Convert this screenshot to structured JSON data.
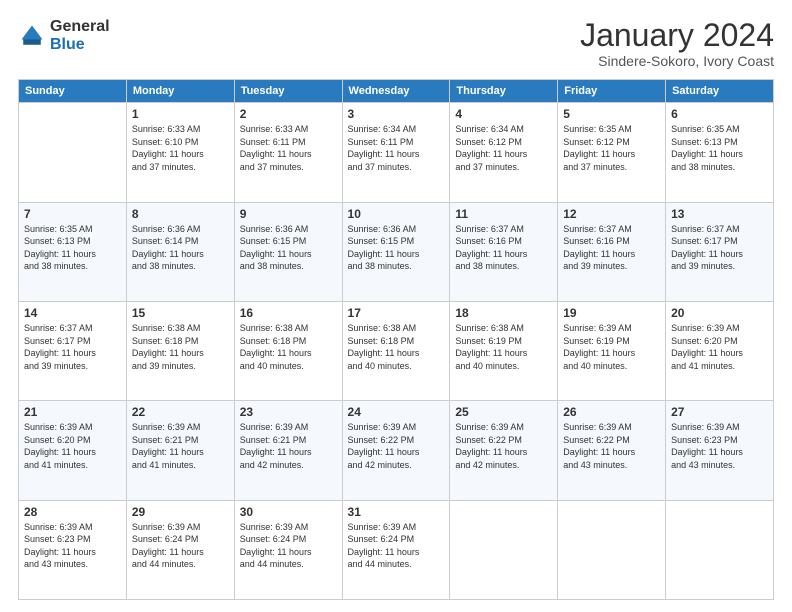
{
  "logo": {
    "general": "General",
    "blue": "Blue"
  },
  "title": "January 2024",
  "subtitle": "Sindere-Sokoro, Ivory Coast",
  "days_of_week": [
    "Sunday",
    "Monday",
    "Tuesday",
    "Wednesday",
    "Thursday",
    "Friday",
    "Saturday"
  ],
  "weeks": [
    [
      {
        "day": "",
        "info": ""
      },
      {
        "day": "1",
        "info": "Sunrise: 6:33 AM\nSunset: 6:10 PM\nDaylight: 11 hours\nand 37 minutes."
      },
      {
        "day": "2",
        "info": "Sunrise: 6:33 AM\nSunset: 6:11 PM\nDaylight: 11 hours\nand 37 minutes."
      },
      {
        "day": "3",
        "info": "Sunrise: 6:34 AM\nSunset: 6:11 PM\nDaylight: 11 hours\nand 37 minutes."
      },
      {
        "day": "4",
        "info": "Sunrise: 6:34 AM\nSunset: 6:12 PM\nDaylight: 11 hours\nand 37 minutes."
      },
      {
        "day": "5",
        "info": "Sunrise: 6:35 AM\nSunset: 6:12 PM\nDaylight: 11 hours\nand 37 minutes."
      },
      {
        "day": "6",
        "info": "Sunrise: 6:35 AM\nSunset: 6:13 PM\nDaylight: 11 hours\nand 38 minutes."
      }
    ],
    [
      {
        "day": "7",
        "info": "Sunrise: 6:35 AM\nSunset: 6:13 PM\nDaylight: 11 hours\nand 38 minutes."
      },
      {
        "day": "8",
        "info": "Sunrise: 6:36 AM\nSunset: 6:14 PM\nDaylight: 11 hours\nand 38 minutes."
      },
      {
        "day": "9",
        "info": "Sunrise: 6:36 AM\nSunset: 6:15 PM\nDaylight: 11 hours\nand 38 minutes."
      },
      {
        "day": "10",
        "info": "Sunrise: 6:36 AM\nSunset: 6:15 PM\nDaylight: 11 hours\nand 38 minutes."
      },
      {
        "day": "11",
        "info": "Sunrise: 6:37 AM\nSunset: 6:16 PM\nDaylight: 11 hours\nand 38 minutes."
      },
      {
        "day": "12",
        "info": "Sunrise: 6:37 AM\nSunset: 6:16 PM\nDaylight: 11 hours\nand 39 minutes."
      },
      {
        "day": "13",
        "info": "Sunrise: 6:37 AM\nSunset: 6:17 PM\nDaylight: 11 hours\nand 39 minutes."
      }
    ],
    [
      {
        "day": "14",
        "info": "Sunrise: 6:37 AM\nSunset: 6:17 PM\nDaylight: 11 hours\nand 39 minutes."
      },
      {
        "day": "15",
        "info": "Sunrise: 6:38 AM\nSunset: 6:18 PM\nDaylight: 11 hours\nand 39 minutes."
      },
      {
        "day": "16",
        "info": "Sunrise: 6:38 AM\nSunset: 6:18 PM\nDaylight: 11 hours\nand 40 minutes."
      },
      {
        "day": "17",
        "info": "Sunrise: 6:38 AM\nSunset: 6:18 PM\nDaylight: 11 hours\nand 40 minutes."
      },
      {
        "day": "18",
        "info": "Sunrise: 6:38 AM\nSunset: 6:19 PM\nDaylight: 11 hours\nand 40 minutes."
      },
      {
        "day": "19",
        "info": "Sunrise: 6:39 AM\nSunset: 6:19 PM\nDaylight: 11 hours\nand 40 minutes."
      },
      {
        "day": "20",
        "info": "Sunrise: 6:39 AM\nSunset: 6:20 PM\nDaylight: 11 hours\nand 41 minutes."
      }
    ],
    [
      {
        "day": "21",
        "info": "Sunrise: 6:39 AM\nSunset: 6:20 PM\nDaylight: 11 hours\nand 41 minutes."
      },
      {
        "day": "22",
        "info": "Sunrise: 6:39 AM\nSunset: 6:21 PM\nDaylight: 11 hours\nand 41 minutes."
      },
      {
        "day": "23",
        "info": "Sunrise: 6:39 AM\nSunset: 6:21 PM\nDaylight: 11 hours\nand 42 minutes."
      },
      {
        "day": "24",
        "info": "Sunrise: 6:39 AM\nSunset: 6:22 PM\nDaylight: 11 hours\nand 42 minutes."
      },
      {
        "day": "25",
        "info": "Sunrise: 6:39 AM\nSunset: 6:22 PM\nDaylight: 11 hours\nand 42 minutes."
      },
      {
        "day": "26",
        "info": "Sunrise: 6:39 AM\nSunset: 6:22 PM\nDaylight: 11 hours\nand 43 minutes."
      },
      {
        "day": "27",
        "info": "Sunrise: 6:39 AM\nSunset: 6:23 PM\nDaylight: 11 hours\nand 43 minutes."
      }
    ],
    [
      {
        "day": "28",
        "info": "Sunrise: 6:39 AM\nSunset: 6:23 PM\nDaylight: 11 hours\nand 43 minutes."
      },
      {
        "day": "29",
        "info": "Sunrise: 6:39 AM\nSunset: 6:24 PM\nDaylight: 11 hours\nand 44 minutes."
      },
      {
        "day": "30",
        "info": "Sunrise: 6:39 AM\nSunset: 6:24 PM\nDaylight: 11 hours\nand 44 minutes."
      },
      {
        "day": "31",
        "info": "Sunrise: 6:39 AM\nSunset: 6:24 PM\nDaylight: 11 hours\nand 44 minutes."
      },
      {
        "day": "",
        "info": ""
      },
      {
        "day": "",
        "info": ""
      },
      {
        "day": "",
        "info": ""
      }
    ]
  ]
}
